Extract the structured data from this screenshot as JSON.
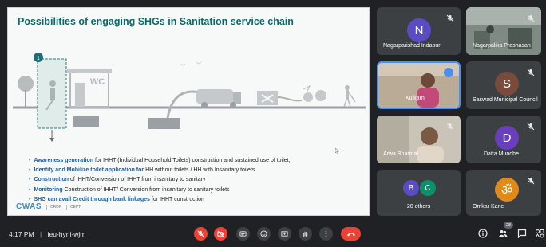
{
  "slide": {
    "title": "Possibilities of engaging SHGs in Sanitation service chain",
    "step_number": "1",
    "wc_label": "WC",
    "bullets": [
      {
        "highlight": "Awareness generation",
        "text": " for IHHT (Individual Household Toilets) construction and sustained use of toilet;"
      },
      {
        "highlight": "Identify and Mobilize toilet application for",
        "text": " HH without toilets / HH with Insanitary toilets"
      },
      {
        "highlight": "Construction",
        "text": " of IHHT/Conversion of IHHT from insanitary to sanitary"
      },
      {
        "highlight": "Monitoring",
        "text": " Construction of IHHT/ Conversion from insanitary to sanitary toilets"
      },
      {
        "highlight": "SHG can avail Credit through bank linkages",
        "text": " for IHHT construction"
      }
    ],
    "logos": [
      "CWAS",
      "CRDF",
      "CEPT"
    ]
  },
  "participants": [
    {
      "name": "Nagarparishad Indapur",
      "initial": "N",
      "color": "#5b4cc4"
    },
    {
      "name": "Nagarpalika Prashasan",
      "initial": "",
      "color": ""
    },
    {
      "name": "Kulkarni",
      "initial": "",
      "color": ""
    },
    {
      "name": "Saswad Municipal Council",
      "initial": "S",
      "color": "#7a4a3a"
    },
    {
      "name": "Arwa Bharmal",
      "initial": "",
      "color": ""
    },
    {
      "name": "Datta Mundhe",
      "initial": "D",
      "color": "#6a3fbf"
    },
    {
      "name": "20 others",
      "initial": "",
      "color": ""
    },
    {
      "name": "Omkar Kane",
      "initial": "ॐ",
      "color": "#e08a1a"
    }
  ],
  "others_avatars": [
    {
      "initial": "B",
      "color": "#5b4cc4"
    },
    {
      "initial": "C",
      "color": "#0d8f6e"
    }
  ],
  "bottom_bar": {
    "time": "4:17 PM",
    "separator": "|",
    "meeting_code": "ieu-hyni-wjm",
    "participant_count": "28"
  },
  "icons": [
    "mic-off-icon",
    "camera-off-icon",
    "captions-icon",
    "emoji-icon",
    "present-icon",
    "raise-hand-icon",
    "more-options-icon",
    "end-call-icon",
    "info-icon",
    "people-icon",
    "chat-icon",
    "activities-icon"
  ],
  "colors": {
    "end_call": "#ea4335",
    "title": "#0c6a6a",
    "highlight": "#1e5fa3",
    "speaking": "#4a8ff0"
  }
}
